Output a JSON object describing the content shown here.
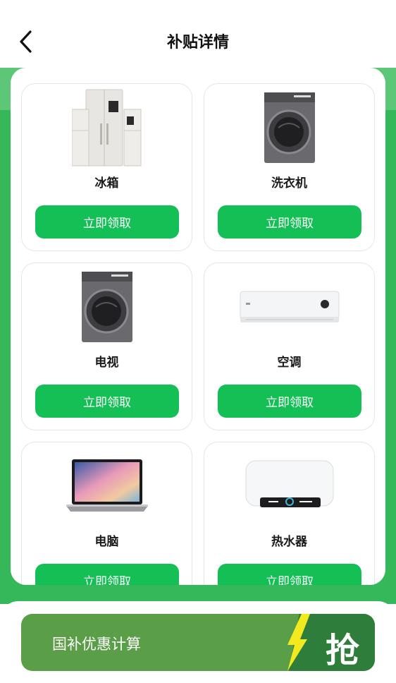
{
  "header": {
    "title": "补贴详情"
  },
  "products": [
    {
      "name": "冰箱",
      "button": "立即领取",
      "image": "fridge-image"
    },
    {
      "name": "洗衣机",
      "button": "立即领取",
      "image": "washer-image"
    },
    {
      "name": "电视",
      "button": "立即领取",
      "image": "washer-image"
    },
    {
      "name": "空调",
      "button": "立即领取",
      "image": "air-conditioner-image"
    },
    {
      "name": "电脑",
      "button": "立即领取",
      "image": "laptop-image"
    },
    {
      "name": "热水器",
      "button": "立即领取",
      "image": "water-heater-image"
    }
  ],
  "footer": {
    "calc_label": "国补优惠计算",
    "grab_label": "抢"
  },
  "colors": {
    "accent_green": "#14c056",
    "bg_green": "#34b85a",
    "bar_green": "#5a9e47",
    "bolt_yellow": "#f2ea1f"
  }
}
